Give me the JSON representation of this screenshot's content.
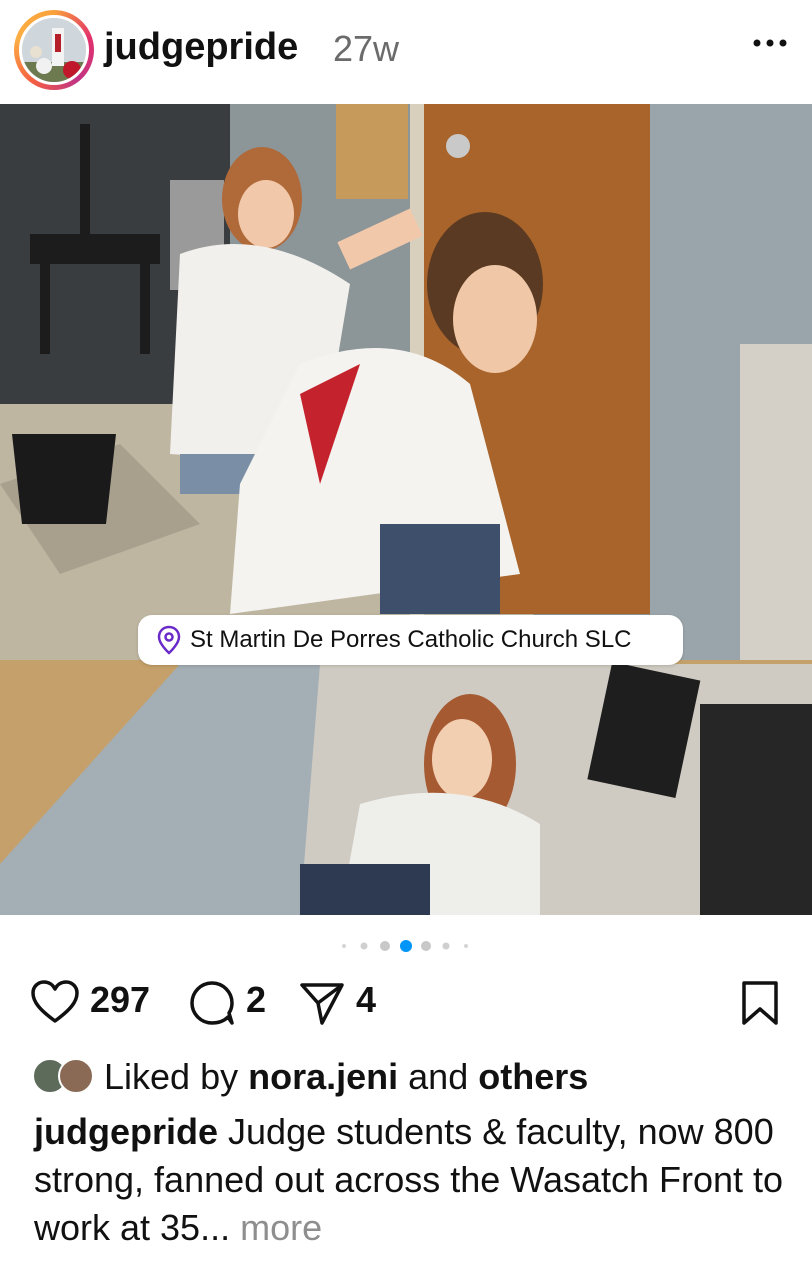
{
  "post": {
    "username": "judgepride",
    "time_ago": "27w",
    "location": "St Martin De Porres Catholic Church SLC",
    "carousel": {
      "total": 6,
      "active_index": 3
    },
    "counts": {
      "likes": "297",
      "comments": "2",
      "shares": "4"
    },
    "liked_by": {
      "prefix": "Liked by",
      "user": "nora.jeni",
      "conj": "and",
      "others": "others"
    },
    "caption": {
      "username": "judgepride",
      "text": "Judge students & faculty, now 800 strong, fanned out across the Wasatch Front to work at 35...",
      "more": "more"
    }
  },
  "icons": {
    "more": "more-horizontal-icon",
    "like": "heart-icon",
    "comment": "comment-icon",
    "share": "send-icon",
    "save": "bookmark-icon",
    "location": "location-pin-icon"
  },
  "colors": {
    "active_dot": "#0095f6",
    "muted_text": "#8e8e8e",
    "text": "#111111"
  }
}
